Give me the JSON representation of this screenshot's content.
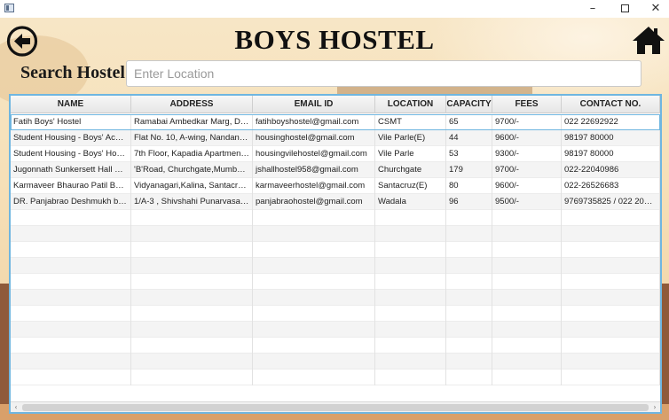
{
  "window": {
    "minimize_glyph": "–",
    "close_glyph": "✕"
  },
  "header": {
    "title": "BOYS HOSTEL",
    "back_icon": "back-arrow-circle-icon",
    "home_icon": "home-icon"
  },
  "search": {
    "label": "Search Hostel",
    "placeholder": "Enter Location",
    "value": ""
  },
  "table": {
    "columns": [
      "NAME",
      "ADDRESS",
      "EMAIL ID",
      "LOCATION",
      "CAPACITY",
      "FEES",
      "CONTACT NO."
    ],
    "rows": [
      [
        "Fatih Boys' Hostel",
        "Ramabai Ambedkar Marg, Dho...",
        "fatihboyshostel@gmail.com",
        "CSMT",
        "65",
        "9700/-",
        "022 22692922"
      ],
      [
        "Student Housing - Boys' Acco...",
        "Flat No. 10, A-wing, Nandanva...",
        "housinghostel@gmail.com",
        "Vile Parle(E)",
        "44",
        "9600/-",
        "98197 80000"
      ],
      [
        "Student Housing - Boys' Hoste...",
        "7th Floor, Kapadia Apartment, ...",
        "housingvilehostel@gmail.com",
        "Vile Parle",
        "53",
        "9300/-",
        "98197 80000"
      ],
      [
        "Jugonnath Sunkersett Hall Hos...",
        "'B'Road, Churchgate,Mumbai-...",
        "jshallhostel958@gmail.com",
        "Churchgate",
        "179",
        "9700/-",
        "022-22040986"
      ],
      [
        "Karmaveer Bhaurao Patil Boys ...",
        "Vidyanagari,Kalina, Santacruz(...",
        "karmaveerhostel@gmail.com",
        "Santacruz(E)",
        "80",
        "9600/-",
        "022-26526683"
      ],
      [
        "DR. Panjabrao Deshmukh boys...",
        "1/A-3 , Shivshahi Punarvasan P...",
        "panjabraohostel@gmail.com",
        "Wadala",
        "96",
        "9500/-",
        "9769735825 / 022 2084 7..."
      ]
    ],
    "empty_row_count": 11,
    "selected_row": 0
  },
  "scrollbar": {
    "left_arrow": "‹",
    "right_arrow": "›"
  },
  "colors": {
    "accent": "#6fb6e0",
    "background": "#f6e0b8"
  }
}
